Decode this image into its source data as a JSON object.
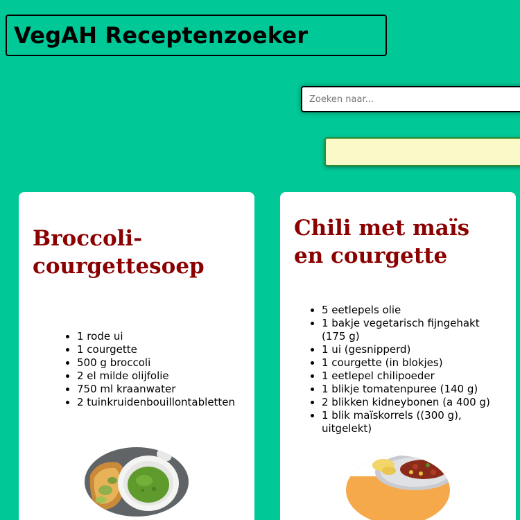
{
  "app": {
    "title": "VegAH Receptenzoeker"
  },
  "search": {
    "placeholder": "Zoeken naar...",
    "value": ""
  },
  "results": {
    "text": ""
  },
  "recipes": [
    {
      "title": "Broccoli-courgettesoep",
      "ingredients": [
        "1 rode ui",
        "1 courgette",
        "500 g broccoli",
        "2 el milde olijfolie",
        "750 ml kraanwater",
        "2 tuinkruidenbouillontabletten"
      ],
      "image": "broccoli-soup-image"
    },
    {
      "title": "Chili met maïs en courgette",
      "ingredients": [
        "5 eetlepels olie",
        "1 bakje vegetarisch fijngehakt (175 g)",
        "1 ui (gesnipperd)",
        "1 courgette (in blokjes)",
        "1 eetlepel chilipoeder",
        "1 blikje tomatenpuree (140 g)",
        "2 blikken kidneybonen (a 400 g)",
        "1 blik maïskorrels ((300 g), uitgelekt)"
      ],
      "image": "chili-dish-image"
    }
  ],
  "colors": {
    "background": "#00c896",
    "card": "#ffffff",
    "title_red": "#8b0000",
    "results_bg": "#fafac8",
    "results_border": "#2e8b2e"
  }
}
